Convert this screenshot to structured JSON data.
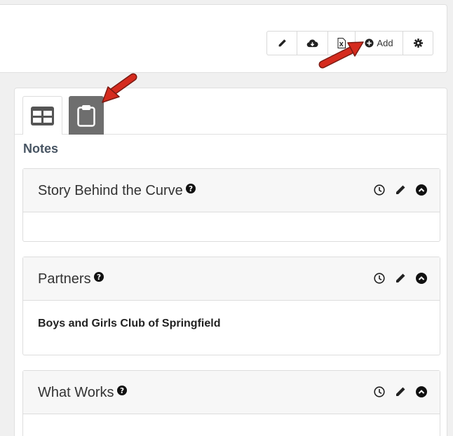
{
  "toolbar": {
    "add_label": "Add",
    "buttons": [
      "pencil-icon",
      "cloud-download-icon",
      "excel-file-icon",
      "plus-circle-icon",
      "gear-icon"
    ]
  },
  "tabs": [
    "table-grid-icon",
    "clipboard-icon"
  ],
  "notes": {
    "heading": "Notes",
    "panels": [
      {
        "title": "Story Behind the Curve",
        "body": ""
      },
      {
        "title": "Partners",
        "body": "Boys and Girls Club of Springfield"
      },
      {
        "title": "What Works",
        "body": ""
      }
    ]
  },
  "colors": {
    "arrow": "#d52b1e",
    "active_tab": "#6e6e6e",
    "heading": "#485563"
  }
}
